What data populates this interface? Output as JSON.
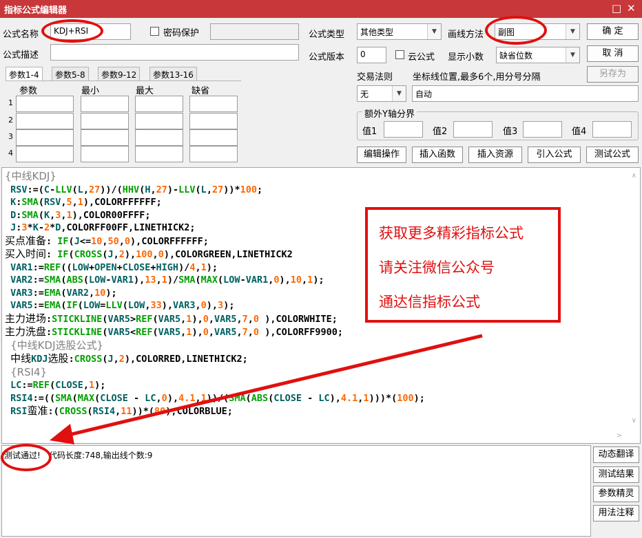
{
  "window": {
    "title": "指标公式编辑器",
    "min_icon": "□",
    "close_icon": "✕"
  },
  "form": {
    "name_label": "公式名称",
    "name_value": "KDJ+RSI",
    "password_label": "密码保护",
    "password_value": "",
    "desc_label": "公式描述",
    "desc_value": "",
    "type_label": "公式类型",
    "type_value": "其他类型",
    "draw_label": "画线方法",
    "draw_value": "副图",
    "version_label": "公式版本",
    "version_value": "0",
    "cloud_label": "云公式",
    "decimal_label": "显示小数",
    "decimal_value": "缺省位数",
    "trade_rule_label": "交易法则",
    "trade_rule_value": "无",
    "coord_label": "坐标线位置,最多6个,用分号分隔",
    "coord_value": "自动",
    "yaxis_group": "额外Y轴分界",
    "y1": "值1",
    "y2": "值2",
    "y3": "值3",
    "y4": "值4"
  },
  "buttons": {
    "ok": "确  定",
    "cancel": "取  消",
    "save_as": "另存为",
    "edit_op": "编辑操作",
    "insert_func": "插入函数",
    "insert_res": "插入资源",
    "import": "引入公式",
    "test": "测试公式"
  },
  "param_tabs": [
    "参数1-4",
    "参数5-8",
    "参数9-12",
    "参数13-16"
  ],
  "param_cols": [
    "参数",
    "最小",
    "最大",
    "缺省"
  ],
  "param_rows": [
    "1",
    "2",
    "3",
    "4"
  ],
  "code_lines": [
    "{中线KDJ}",
    "RSV:=(C-LLV(L,27))/(HHV(H,27)-LLV(L,27))*100;",
    "K:SMA(RSV,5,1),COLORFFFFFF;",
    "D:SMA(K,3,1),COLOR00FFFF;",
    "J:3*K-2*D,COLORFF00FF,LINETHICK2;",
    "买点准备: IF(J<=10,50,0),COLORFFFFFF;",
    "买入时间: IF(CROSS(J,2),100,0),COLORGREEN,LINETHICK2",
    "VAR1:=REF((LOW+OPEN+CLOSE+HIGH)/4,1);",
    "VAR2:=SMA(ABS(LOW-VAR1),13,1)/SMA(MAX(LOW-VAR1,0),10,1);",
    "VAR3:=EMA(VAR2,10);",
    "VAR5:=EMA(IF(LOW=LLV(LOW,33),VAR3,0),3);",
    "主力进场:STICKLINE(VAR5>REF(VAR5,1),0,VAR5,7,0 ),COLORWHITE;",
    "主力洗盘:STICKLINE(VAR5<REF(VAR5,1),0,VAR5,7,0 ),COLORFF9900;",
    "{中线KDJ选股公式}",
    "中线KDJ选股:CROSS(J,2),COLORRED,LINETHICK2;",
    "{RSI4}",
    "LC:=REF(CLOSE,1);",
    "RSI4:=((SMA(MAX(CLOSE - LC,0),4.1,1))/(SMA(ABS(CLOSE - LC),4.1,1)))*(100);",
    "RSI蛮准:(CROSS(RSI4,11))*(80),COLORBLUE;"
  ],
  "output": {
    "status": "测试通过!",
    "info": "代码长度:748,输出线个数:9"
  },
  "side_buttons": [
    "动态翻译",
    "测试结果",
    "参数精灵",
    "用法注释"
  ],
  "promo": [
    "获取更多精彩指标公式",
    "请关注微信公众号",
    "通达信指标公式"
  ],
  "scroll": {
    "up": "∧",
    "down": "∨",
    "right": ">"
  },
  "colors": {
    "titlebar": "#c8373a",
    "annotation": "#e01010",
    "func": "#00a000",
    "number": "#ff6600",
    "ident": "#006060"
  }
}
